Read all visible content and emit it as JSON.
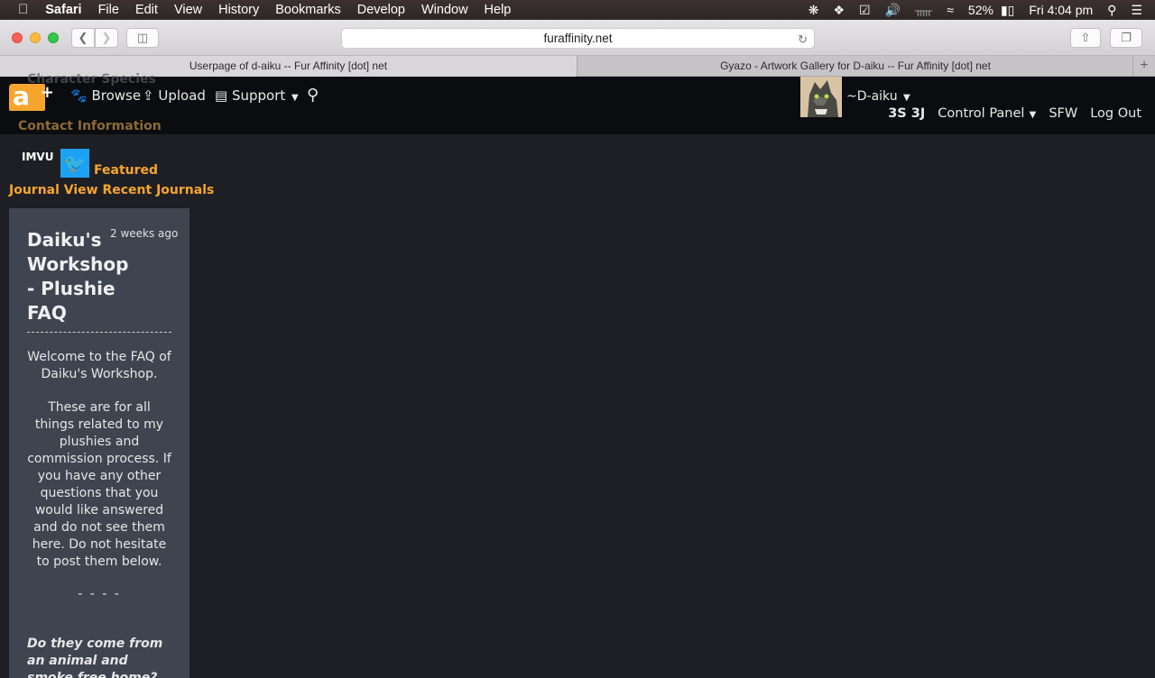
{
  "menubar": {
    "app": "Safari",
    "items": [
      "File",
      "Edit",
      "View",
      "History",
      "Bookmarks",
      "Develop",
      "Window",
      "Help"
    ],
    "battery": "52%",
    "clock": "Fri 4:04 pm"
  },
  "browser": {
    "url": "furaffinity.net",
    "tabs": [
      {
        "title": "Userpage of d-aiku -- Fur Affinity [dot] net"
      },
      {
        "title": "Gyazo - Artwork Gallery for D-aiku -- Fur Affinity [dot] net"
      }
    ]
  },
  "site": {
    "nav": {
      "browse": "Browse",
      "upload": "Upload",
      "support": "Support"
    },
    "ghost_labels": {
      "species": "Character Species",
      "contact": "Contact Information"
    },
    "user": {
      "name": "~D-aiku",
      "counts": "3S 3J",
      "control_panel": "Control Panel",
      "sfw": "SFW",
      "logout": "Log Out"
    },
    "sidebar": {
      "featured": "Featured",
      "journal_links": "Journal View Recent Journals",
      "imvu": "IMVU"
    },
    "journal": {
      "title": "Daiku's Workshop - Plushie FAQ",
      "time": "2 weeks ago",
      "p1": "Welcome to the FAQ of Daiku's Workshop.",
      "p2": "These are for all things related to my plushies and commission process. If you have any other questions that you would like answered and do not see them here. Do not hesitate to post them below.",
      "divider": "- - - -",
      "question": "Do they come from an animal and smoke free home?"
    }
  },
  "colors": {
    "accent": "#f6a52c",
    "header_bg": "#0b0c0f",
    "page_bg": "#1e1f24",
    "card_bg": "#3f4550",
    "twitter": "#1da1f2"
  }
}
